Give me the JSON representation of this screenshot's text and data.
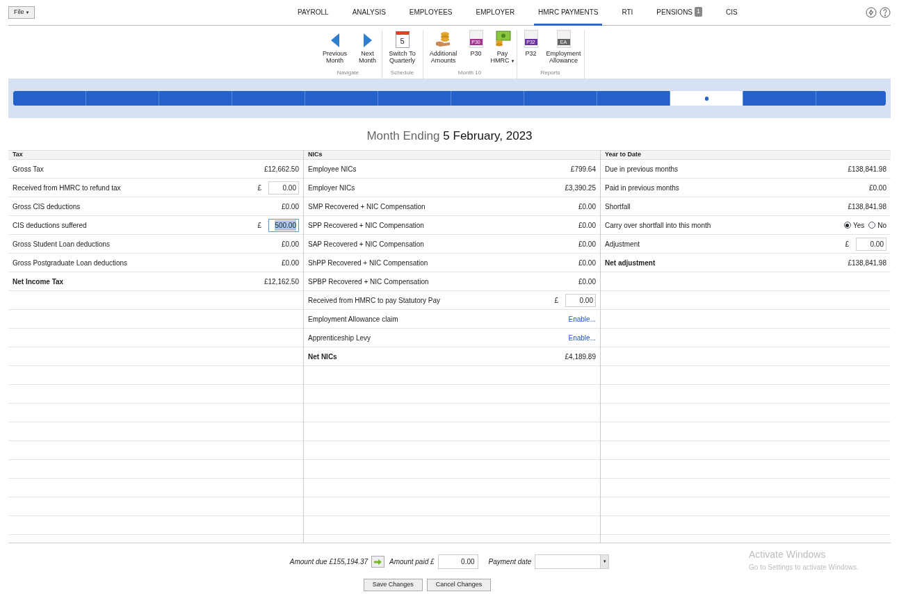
{
  "file_menu": {
    "label": "File",
    "caret": "▼"
  },
  "nav_tabs": [
    {
      "label": "PAYROLL",
      "selected": false
    },
    {
      "label": "ANALYSIS",
      "selected": false
    },
    {
      "label": "EMPLOYEES",
      "selected": false
    },
    {
      "label": "EMPLOYER",
      "selected": false
    },
    {
      "label": "HMRC PAYMENTS",
      "selected": true
    },
    {
      "label": "RTI",
      "selected": false
    },
    {
      "label": "PENSIONS",
      "selected": false,
      "badge": "1"
    },
    {
      "label": "CIS",
      "selected": false
    }
  ],
  "toolbar": [
    {
      "label": "Navigate",
      "buttons": [
        {
          "label": "Previous Month"
        },
        {
          "label": "Next Month"
        }
      ]
    },
    {
      "label": "Schedule",
      "buttons": [
        {
          "label": "Switch To Quarterly",
          "icon_text": "5"
        }
      ]
    },
    {
      "label": "Month 10",
      "buttons": [
        {
          "label": "Additional Amounts"
        },
        {
          "label": "P30",
          "icon_text": "P30"
        },
        {
          "label": "Pay HMRC",
          "caret": "▼"
        }
      ]
    },
    {
      "label": "Reports",
      "buttons": [
        {
          "label": "P32",
          "icon_text": "P32"
        },
        {
          "label": "Employment Allowance",
          "icon_text": "EA"
        }
      ]
    }
  ],
  "timeline": [
    {
      "selected": false
    },
    {
      "selected": false
    },
    {
      "selected": false
    },
    {
      "selected": false
    },
    {
      "selected": false
    },
    {
      "selected": false
    },
    {
      "selected": false
    },
    {
      "selected": false
    },
    {
      "selected": false
    },
    {
      "selected": true
    },
    {
      "selected": false
    },
    {
      "selected": false
    }
  ],
  "heading": {
    "prefix": "Month Ending",
    "date": "5 February, 2023"
  },
  "panels": [
    {
      "title": "Tax",
      "rows": [
        {
          "kind": "value",
          "label": "Gross Tax",
          "value": "£12,662.50"
        },
        {
          "kind": "input",
          "label": "Received from HMRC to refund tax",
          "currency": "£",
          "value": "0.00",
          "focused": false
        },
        {
          "kind": "value",
          "label": "Gross CIS deductions",
          "value": "£0.00"
        },
        {
          "kind": "input",
          "label": "CIS deductions suffered",
          "currency": "£",
          "value": "500.00",
          "focused": true
        },
        {
          "kind": "value",
          "label": "Gross Student Loan deductions",
          "value": "£0.00"
        },
        {
          "kind": "value",
          "label": "Gross Postgraduate Loan deductions",
          "value": "£0.00"
        },
        {
          "kind": "total",
          "label": "Net Income Tax",
          "value": "£12,162.50"
        }
      ]
    },
    {
      "title": "NICs",
      "rows": [
        {
          "kind": "value",
          "label": "Employee NICs",
          "value": "£799.64"
        },
        {
          "kind": "value",
          "label": "Employer NICs",
          "value": "£3,390.25"
        },
        {
          "kind": "value",
          "label": "SMP Recovered + NIC Compensation",
          "value": "£0.00"
        },
        {
          "kind": "value",
          "label": "SPP Recovered + NIC Compensation",
          "value": "£0.00"
        },
        {
          "kind": "value",
          "label": "SAP Recovered + NIC Compensation",
          "value": "£0.00"
        },
        {
          "kind": "value",
          "label": "ShPP Recovered + NIC Compensation",
          "value": "£0.00"
        },
        {
          "kind": "value",
          "label": "SPBP Recovered + NIC Compensation",
          "value": "£0.00"
        },
        {
          "kind": "input",
          "label": "Received from HMRC to pay Statutory Pay",
          "currency": "£",
          "value": "0.00",
          "focused": false
        },
        {
          "kind": "link",
          "label": "Employment Allowance claim",
          "value": "Enable..."
        },
        {
          "kind": "link",
          "label": "Apprenticeship Levy",
          "value": "Enable..."
        },
        {
          "kind": "total",
          "label": "Net NICs",
          "value": "£4,189.89"
        }
      ]
    },
    {
      "title": "Year to Date",
      "rows": [
        {
          "kind": "value",
          "label": "Due in previous months",
          "value": "£138,841.98"
        },
        {
          "kind": "value",
          "label": "Paid in previous months",
          "value": "£0.00"
        },
        {
          "kind": "value",
          "label": "Shortfall",
          "value": "£138,841.98"
        },
        {
          "kind": "radio",
          "label": "Carry over shortfall into this month",
          "options": [
            {
              "label": "Yes",
              "selected": true
            },
            {
              "label": "No",
              "selected": false
            }
          ]
        },
        {
          "kind": "input",
          "label": "Adjustment",
          "currency": "£",
          "value": "0.00",
          "focused": false
        },
        {
          "kind": "total",
          "label": "Net adjustment",
          "value": "£138,841.98"
        }
      ]
    }
  ],
  "footer": {
    "amount_due": "Amount due £155,194.37",
    "amount_paid_label": "Amount paid £",
    "amount_paid": "0.00",
    "payment_date_label": "Payment date",
    "payment_date_arrow": "▼",
    "buttons": [
      "Save Changes",
      "Cancel Changes"
    ]
  },
  "activation": {
    "title": "Activate Windows",
    "text": "Go to Settings to activate Windows."
  }
}
